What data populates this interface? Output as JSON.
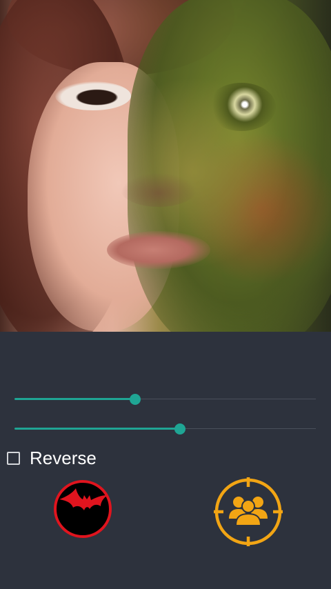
{
  "photo": {
    "icon": "face-blend-photo"
  },
  "sliders": [
    {
      "value_percent": 40
    },
    {
      "value_percent": 55
    }
  ],
  "reverse": {
    "label": "Reverse",
    "checked": false
  },
  "buttons": {
    "bat": {
      "icon": "bat-icon",
      "color": "#e0141e"
    },
    "group": {
      "icon": "group-target-icon",
      "color": "#f2a514"
    }
  },
  "colors": {
    "accent": "#1fa594",
    "background": "#2d323d"
  }
}
